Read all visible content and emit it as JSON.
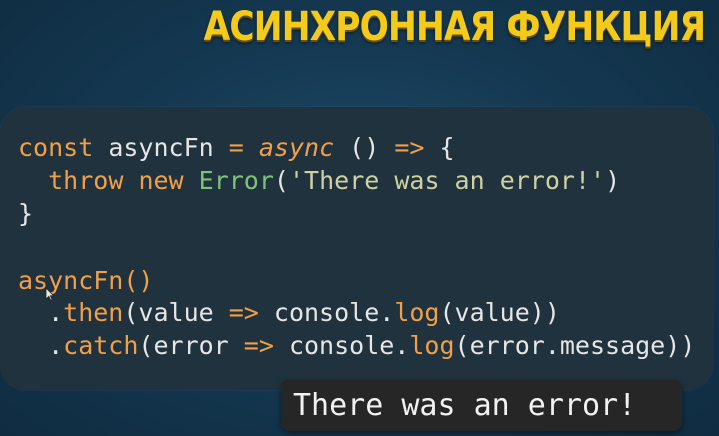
{
  "title": "АСИНХРОННАЯ ФУНКЦИЯ",
  "code": {
    "line1": {
      "kw": "const",
      "name": " asyncFn ",
      "eq": "=",
      "space": " ",
      "async": "async",
      "paren": " () ",
      "arrow": "=>",
      "brace": " {"
    },
    "line2": {
      "indent": "  ",
      "throw": "throw",
      "sp1": " ",
      "new": "new",
      "sp2": " ",
      "cls": "Error",
      "open": "(",
      "str": "'There was an error!'",
      "close": ")"
    },
    "line3": {
      "brace": "}"
    },
    "line4": {
      "call": "asyncFn()"
    },
    "line5": {
      "indent": "  .",
      "then": "then",
      "args": "(value ",
      "arrow": "=>",
      "console": " console.",
      "log": "log",
      "rest": "(value))"
    },
    "line6": {
      "indent": "  .",
      "catch": "catch",
      "args": "(error ",
      "arrow": "=>",
      "console": " console.",
      "log": "log",
      "rest": "(error.message))"
    }
  },
  "output": {
    "text": "There was an error!"
  },
  "colors": {
    "accent": "#f4cb1b",
    "keyword": "#f0a04b",
    "class": "#7ec379",
    "panel": "#20323e"
  },
  "icons": {
    "cursor": "mouse-pointer-icon"
  }
}
